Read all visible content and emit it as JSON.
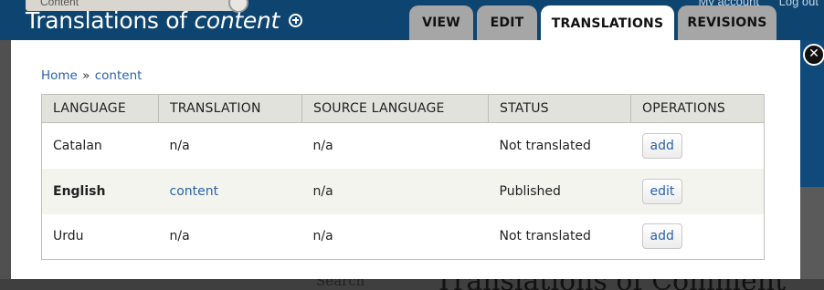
{
  "background": {
    "menu_item": "Content",
    "user_links": [
      "My account",
      "Log out"
    ],
    "search_label": "Search",
    "page_heading": "Translations of Comment"
  },
  "header": {
    "title_prefix": "Translations of ",
    "title_entity": "content",
    "shortcut_icon": "add-shortcut-icon",
    "tabs": [
      {
        "label": "VIEW",
        "active": false
      },
      {
        "label": "EDIT",
        "active": false
      },
      {
        "label": "TRANSLATIONS",
        "active": true
      },
      {
        "label": "REVISIONS",
        "active": false
      }
    ]
  },
  "overlay": {
    "close_icon": "close-icon",
    "breadcrumb": [
      {
        "label": "Home"
      },
      {
        "label": "content"
      }
    ],
    "breadcrumb_separator": "»",
    "table": {
      "headers": [
        "LANGUAGE",
        "TRANSLATION",
        "SOURCE LANGUAGE",
        "STATUS",
        "OPERATIONS"
      ],
      "rows": [
        {
          "language": "Catalan",
          "translation": "n/a",
          "source_language": "n/a",
          "status": "Not translated",
          "operation": "add",
          "current": false
        },
        {
          "language": "English",
          "translation": "content",
          "source_language": "n/a",
          "status": "Published",
          "operation": "edit",
          "current": true
        },
        {
          "language": "Urdu",
          "translation": "n/a",
          "source_language": "n/a",
          "status": "Not translated",
          "operation": "add",
          "current": false
        }
      ]
    }
  },
  "colors": {
    "toolbar_blue": "#0e4470",
    "link_blue": "#2a63a8",
    "tab_inactive": "#a6a6a6",
    "table_header": "#e1e2dc"
  }
}
